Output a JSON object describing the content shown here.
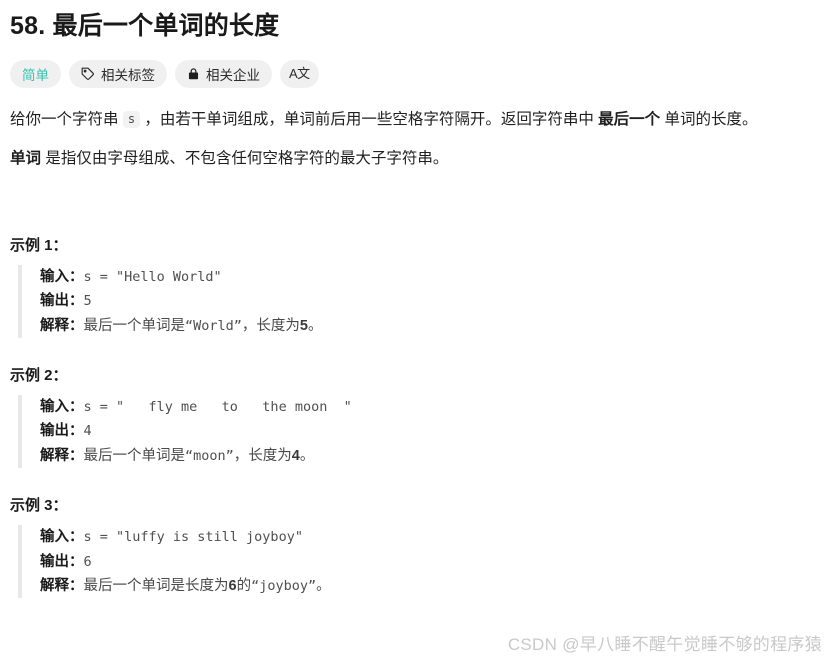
{
  "problem": {
    "number": "58.",
    "title": "最后一个单词的长度",
    "full_title": "58. 最后一个单词的长度"
  },
  "badges": [
    {
      "label": "简单",
      "icon": "none",
      "color": "#35c1b0"
    },
    {
      "label": "相关标签",
      "icon": "tag-icon",
      "color": "#2b2b2b"
    },
    {
      "label": "相关企业",
      "icon": "lock-icon",
      "color": "#2b2b2b"
    },
    {
      "label": "A文",
      "icon": "translate-icon",
      "color": "#2b2b2b"
    }
  ],
  "description": {
    "p1_part1": "给你一个字符串 ",
    "p1_code": "s",
    "p1_part2": " ，由若干单词组成，单词前后用一些空格字符隔开。返回字符串中 ",
    "p1_bold": "最后一个",
    "p1_part3": " 单词的长度。",
    "p2_bold": "单词",
    "p2_rest": " 是指仅由字母组成、不包含任何空格字符的最大子字符串。"
  },
  "examples": [
    {
      "heading": "示例 1：",
      "input_label": "输入",
      "input_value": "s = \"Hello World\"",
      "output_label": "输出",
      "output_value": "5",
      "explain_label": "解释",
      "explain_pre": "最后一个单词是",
      "explain_code": "“World”",
      "explain_mid": "，长度为",
      "explain_num": "5",
      "explain_post": "。"
    },
    {
      "heading": "示例 2：",
      "input_label": "输入",
      "input_value": "s = \"   fly me   to   the moon  \"",
      "output_label": "输出",
      "output_value": "4",
      "explain_label": "解释",
      "explain_pre": "最后一个单词是",
      "explain_code": "“moon”",
      "explain_mid": "，长度为",
      "explain_num": "4",
      "explain_post": "。"
    },
    {
      "heading": "示例 3：",
      "input_label": "输入",
      "input_value": "s = \"luffy is still joyboy\"",
      "output_label": "输出",
      "output_value": "6",
      "explain_label": "解释",
      "explain_pre": "最后一个单词是长度为",
      "explain_num": "6",
      "explain_mid": "的",
      "explain_code": "“joyboy”",
      "explain_post": "。"
    }
  ],
  "watermark": {
    "text": "CSDN @早八睡不醒午觉睡不够的程序猿"
  }
}
